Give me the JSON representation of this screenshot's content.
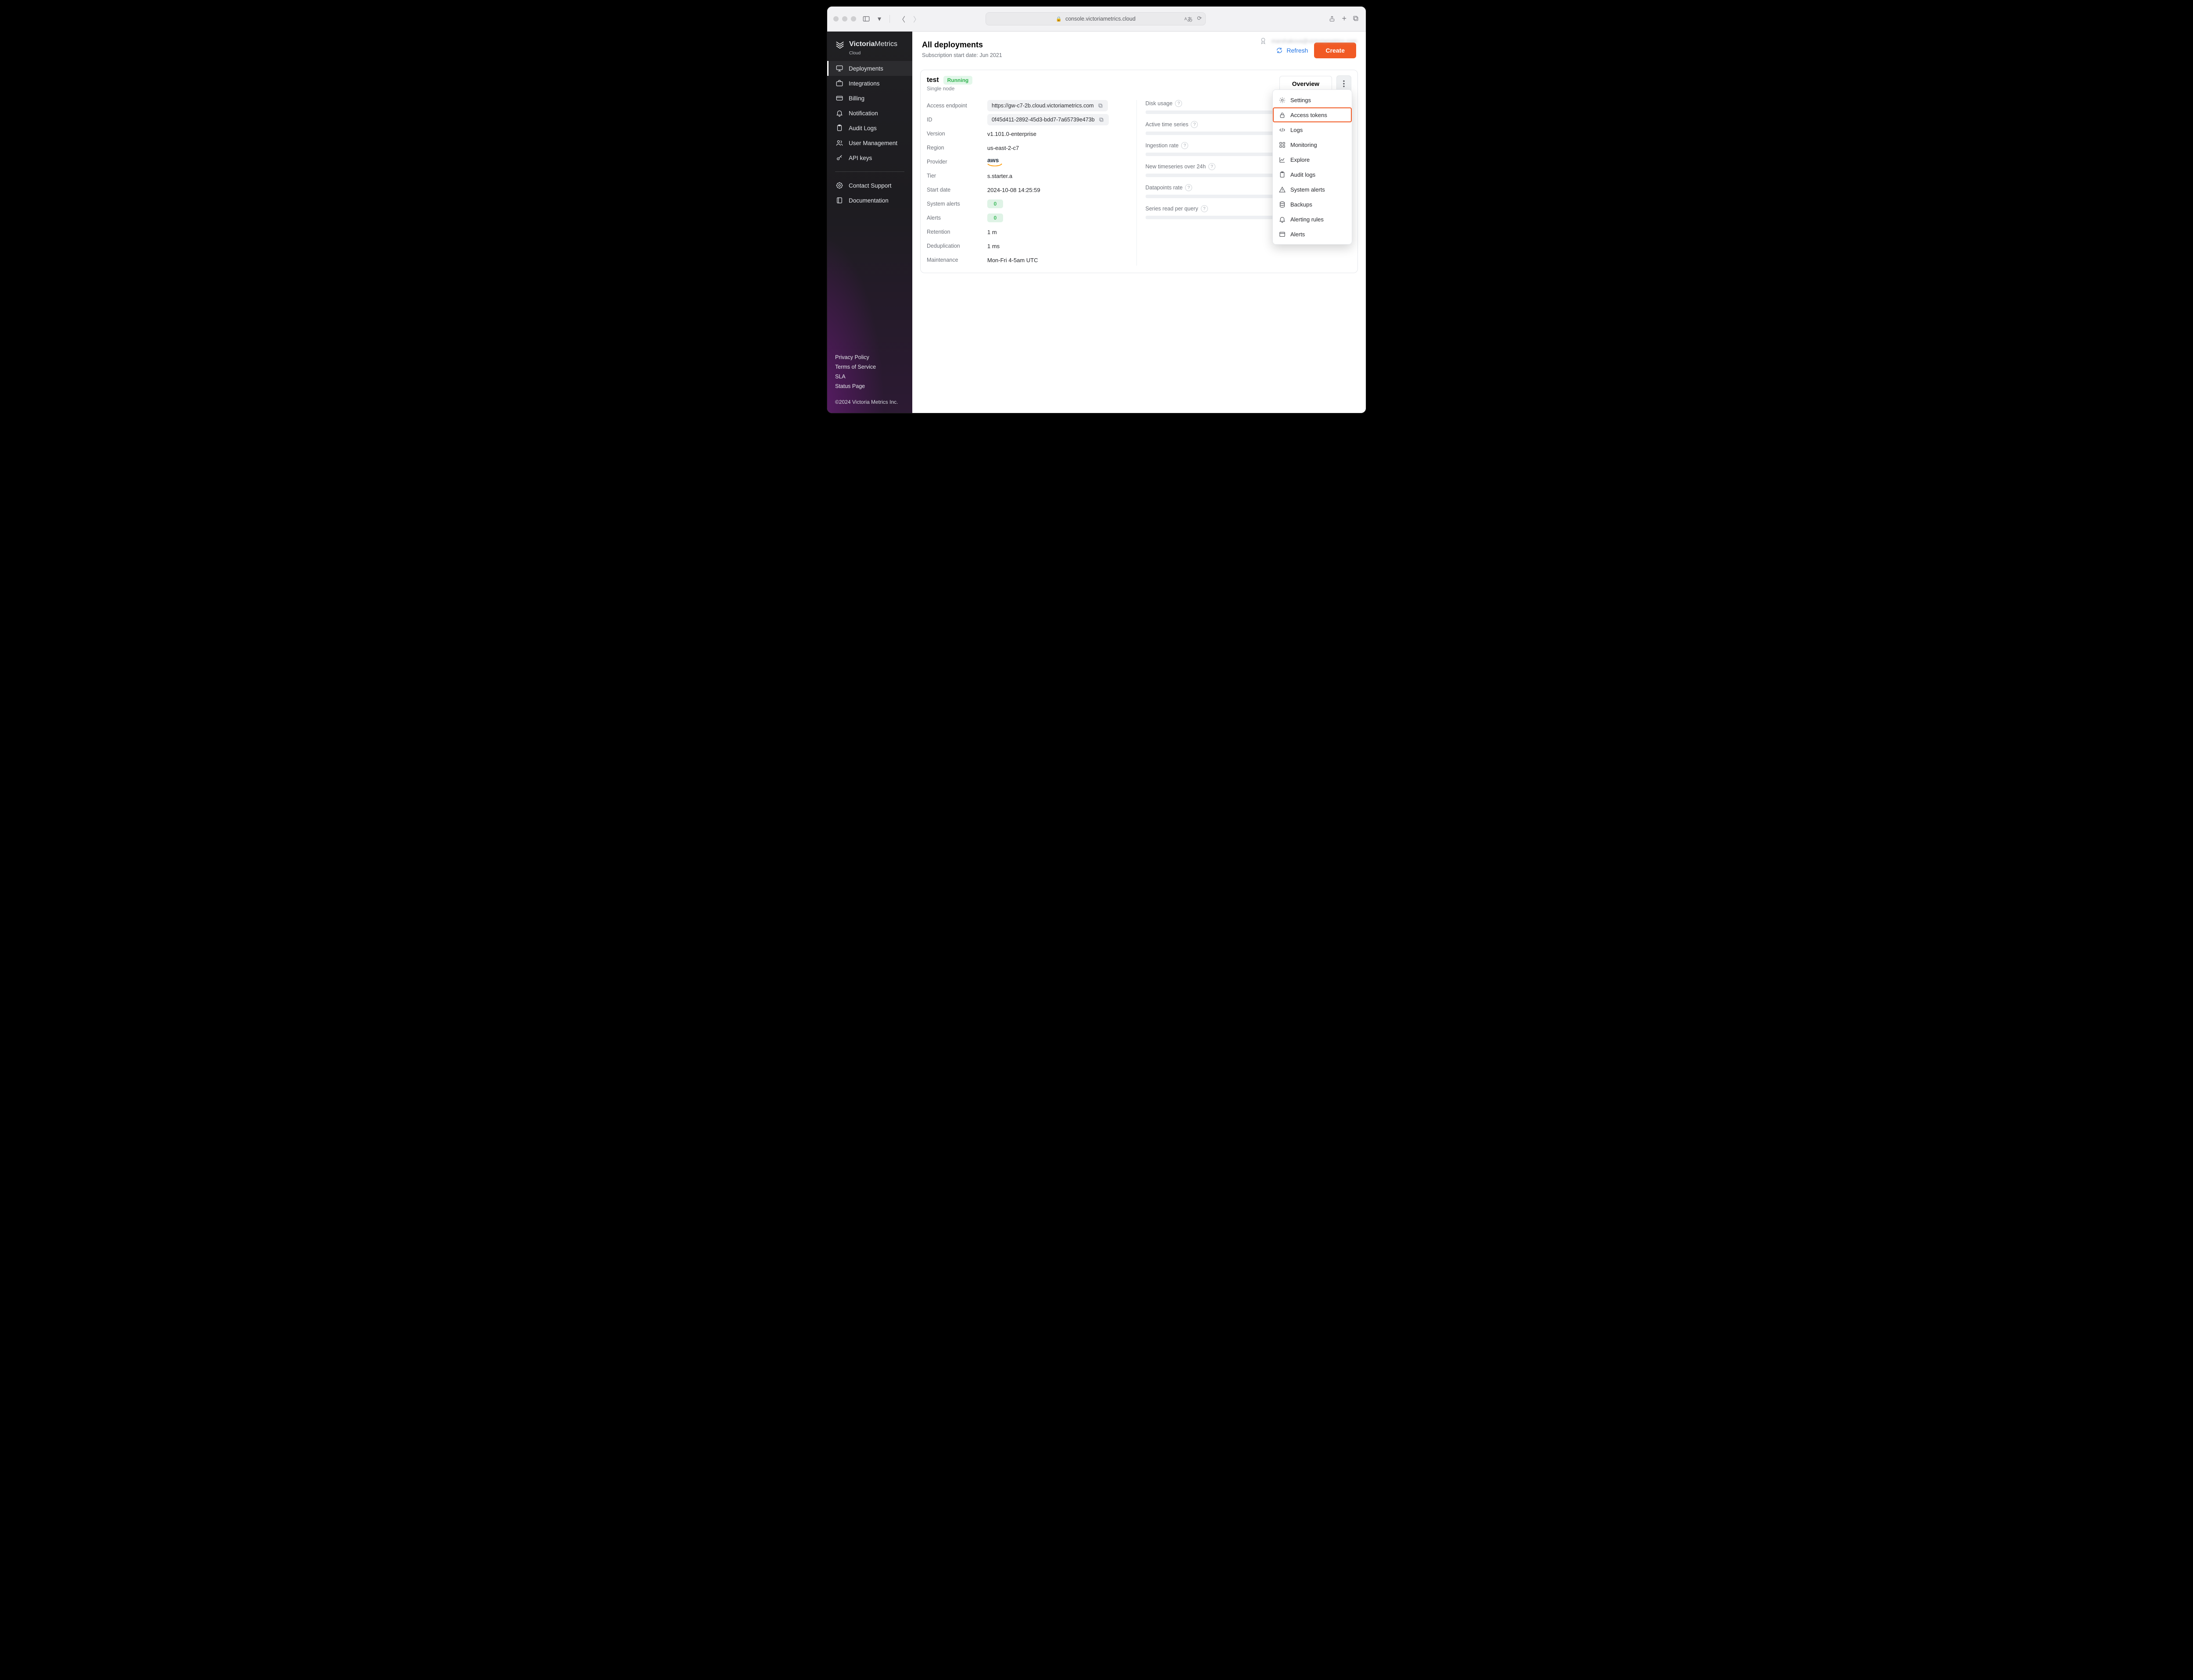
{
  "browser": {
    "url": "console.victoriametrics.cloud"
  },
  "account": {
    "email_preview": "marshakova@victoriametrics.com"
  },
  "brand": {
    "name_bold": "Victoria",
    "name_light": "Metrics",
    "sub": "Cloud"
  },
  "sidebar": {
    "items": [
      {
        "label": "Deployments",
        "icon": "monitor"
      },
      {
        "label": "Integrations",
        "icon": "briefcase"
      },
      {
        "label": "Billing",
        "icon": "card"
      },
      {
        "label": "Notification",
        "icon": "bell"
      },
      {
        "label": "Audit Logs",
        "icon": "clipboard"
      },
      {
        "label": "User Management",
        "icon": "users"
      },
      {
        "label": "API keys",
        "icon": "key"
      }
    ],
    "secondary": [
      {
        "label": "Contact Support",
        "icon": "bug"
      },
      {
        "label": "Documentation",
        "icon": "book"
      }
    ],
    "footer_links": [
      {
        "label": "Privacy Policy"
      },
      {
        "label": "Terms of Service"
      },
      {
        "label": "SLA"
      },
      {
        "label": "Status Page"
      }
    ],
    "copyright": "©2024 Victoria Metrics Inc."
  },
  "page": {
    "title": "All deployments",
    "subscription_prefix": "Subscription start date: ",
    "subscription_date": "Jun 2021",
    "refresh_label": "Refresh",
    "create_label": "Create"
  },
  "deployment": {
    "name": "test",
    "status": "Running",
    "type": "Single node",
    "overview_label": "Overview",
    "fields": {
      "access_endpoint": {
        "k": "Access endpoint",
        "v": "https://gw-c7-2b.cloud.victoriametrics.com"
      },
      "id": {
        "k": "ID",
        "v": "0f45d411-2892-45d3-bdd7-7a65739e473b"
      },
      "version": {
        "k": "Version",
        "v": "v1.101.0-enterprise"
      },
      "region": {
        "k": "Region",
        "v": "us-east-2-c7"
      },
      "provider": {
        "k": "Provider",
        "v": "aws"
      },
      "tier": {
        "k": "Tier",
        "v": "s.starter.a"
      },
      "start_date": {
        "k": "Start date",
        "v": "2024-10-08 14:25:59"
      },
      "system_alerts": {
        "k": "System alerts",
        "v": "0"
      },
      "alerts": {
        "k": "Alerts",
        "v": "0"
      },
      "retention": {
        "k": "Retention",
        "v": "1 m"
      },
      "deduplication": {
        "k": "Deduplication",
        "v": "1 ms"
      },
      "maintenance": {
        "k": "Maintenance",
        "v": "Mon-Fri 4-5am UTC"
      }
    },
    "metrics": [
      {
        "label": "Disk usage"
      },
      {
        "label": "Active time series"
      },
      {
        "label": "Ingestion rate"
      },
      {
        "label": "New timeseries over 24h"
      },
      {
        "label": "Datapoints rate"
      },
      {
        "label": "Series read per query"
      }
    ]
  },
  "menu": {
    "items": [
      {
        "label": "Settings",
        "icon": "gear"
      },
      {
        "label": "Access tokens",
        "icon": "lock",
        "highlight": true
      },
      {
        "label": "Logs",
        "icon": "code"
      },
      {
        "label": "Monitoring",
        "icon": "grid"
      },
      {
        "label": "Explore",
        "icon": "chart"
      },
      {
        "label": "Audit logs",
        "icon": "clipboard"
      },
      {
        "label": "System alerts",
        "icon": "warning"
      },
      {
        "label": "Backups",
        "icon": "db"
      },
      {
        "label": "Alerting rules",
        "icon": "bell"
      },
      {
        "label": "Alerts",
        "icon": "window"
      }
    ]
  }
}
